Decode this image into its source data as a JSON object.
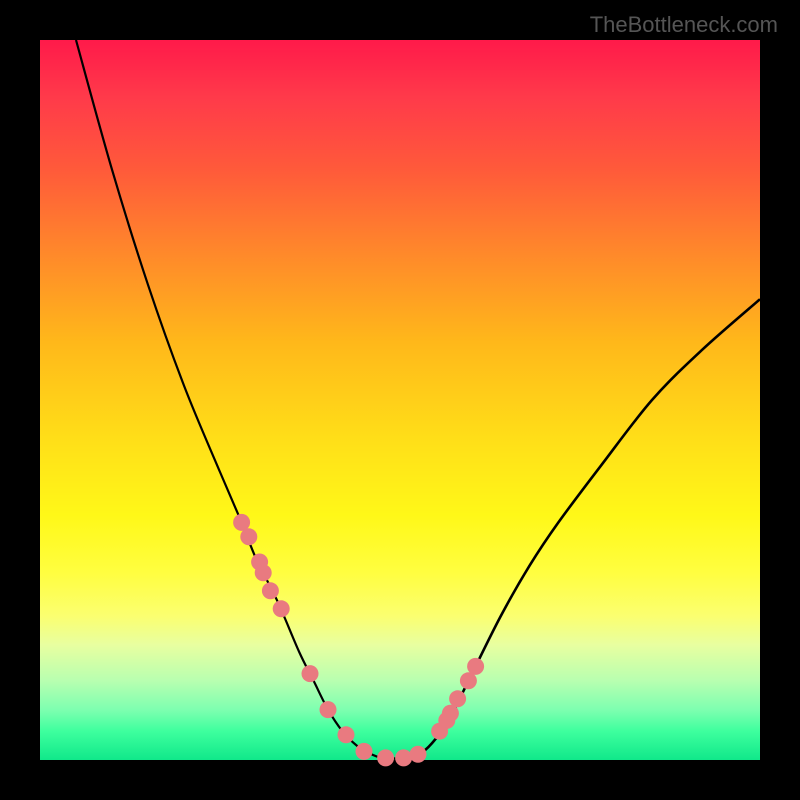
{
  "watermark": "TheBottleneck.com",
  "chart_data": {
    "type": "line",
    "title": "",
    "xlabel": "",
    "ylabel": "",
    "xlim": [
      0,
      100
    ],
    "ylim": [
      0,
      100
    ],
    "series": [
      {
        "name": "bottleneck-curve",
        "x": [
          5,
          10,
          15,
          20,
          25,
          28,
          30,
          33,
          36,
          38,
          40,
          42,
          44,
          46,
          47.5,
          49,
          51,
          53,
          55,
          57,
          60,
          64,
          68,
          72,
          78,
          85,
          92,
          100
        ],
        "y": [
          100,
          82,
          66,
          52,
          40,
          33,
          28,
          22,
          15,
          11,
          7,
          4,
          2,
          0.8,
          0.3,
          0.2,
          0.3,
          1,
          3,
          6,
          12,
          20,
          27,
          33,
          41,
          50,
          57,
          64
        ]
      }
    ],
    "markers": {
      "name": "highlight-dots",
      "x": [
        28.0,
        29.0,
        30.5,
        31.0,
        32.0,
        33.5,
        37.5,
        40.0,
        42.5,
        45.0,
        48.0,
        50.5,
        52.5,
        55.5,
        56.5,
        57.0,
        58.0,
        59.5,
        60.5
      ],
      "y": [
        33.0,
        31.0,
        27.5,
        26.0,
        23.5,
        21.0,
        12.0,
        7.0,
        3.5,
        1.2,
        0.3,
        0.3,
        0.8,
        4.0,
        5.5,
        6.5,
        8.5,
        11.0,
        13.0
      ]
    },
    "gradient_axis": "y",
    "gradient_meaning": "high=red (bad), low=green (good)"
  }
}
